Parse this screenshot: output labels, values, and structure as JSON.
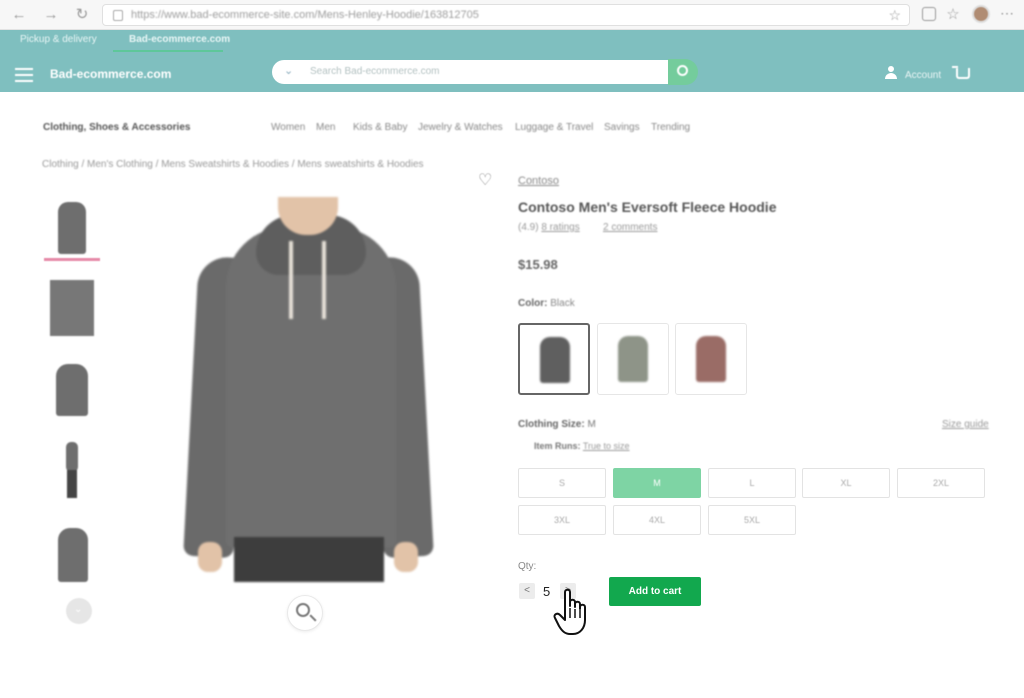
{
  "browser": {
    "url": "https://www.bad-ecommerce-site.com/Mens-Henley-Hoodie/163812705",
    "back_icon": "arrow-left-icon",
    "forward_icon": "arrow-right-icon",
    "reload_icon": "reload-icon"
  },
  "header": {
    "subnav": [
      "Pickup & delivery",
      "Bad-ecommerce.com"
    ],
    "brand": "Bad-ecommerce.com",
    "search_placeholder": "Search Bad-ecommerce.com",
    "account_label": "Account",
    "colors": {
      "header_bg": "#7fbfbf",
      "search_button": "#74cc9c"
    }
  },
  "category_nav": {
    "title": "Clothing, Shoes & Accessories",
    "links": [
      "Women",
      "Men",
      "Kids & Baby",
      "Jewelry & Watches",
      "Luggage & Travel",
      "Savings",
      "Trending"
    ]
  },
  "breadcrumb": "Clothing / Men's Clothing / Mens Sweatshirts & Hoodies / Mens sweatshirts & Hoodies",
  "product": {
    "brand": "Contoso",
    "title": "Contoso Men's Eversoft Fleece Hoodie",
    "rating_prefix": "(4.9)",
    "ratings_link": "8 ratings",
    "comments_link": "2 comments",
    "price": "$15.98",
    "color_label": "Color:",
    "color_value": "Black",
    "size_label": "Clothing Size:",
    "size_value": "M",
    "size_guide": "Size guide",
    "item_runs_label": "Item Runs:",
    "item_runs_value": "True to size",
    "sizes": [
      "S",
      "M",
      "L",
      "XL",
      "2XL",
      "3XL",
      "4XL",
      "5XL"
    ],
    "selected_size": "M",
    "swatch_colors": [
      "#5f5f5f",
      "#8e9488",
      "#9a6c66"
    ]
  },
  "cart": {
    "qty_label": "Qty:",
    "qty_value": "5",
    "dec_label": "<",
    "inc_label": ">",
    "add_to_cart": "Add to cart",
    "button_color": "#12a84e"
  }
}
